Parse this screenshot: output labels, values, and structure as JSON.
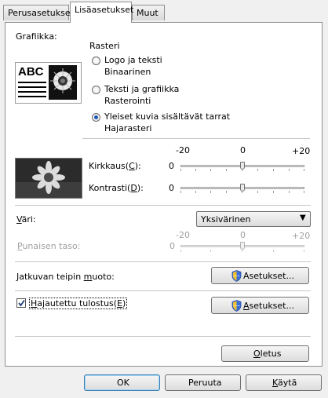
{
  "tabs": [
    {
      "label": "Perusasetukset"
    },
    {
      "label": "Lisäasetukset"
    },
    {
      "label": "Muut"
    }
  ],
  "graphics": {
    "label": "Grafiikka:",
    "sample_text": "ABC",
    "rasteri": "Rasteri",
    "options": [
      {
        "title": "Logo ja teksti",
        "sub": "Binaarinen",
        "selected": false
      },
      {
        "title": "Teksti ja grafiikka",
        "sub": "Rasterointi",
        "selected": false
      },
      {
        "title": "Yleiset kuvia sisältävät tarrat",
        "sub": "Hajarasteri",
        "selected": true
      }
    ]
  },
  "adjust": {
    "scale_min": "-20",
    "scale_mid": "0",
    "scale_max": "+20",
    "brightness_label": "Kirkkaus(C):",
    "brightness_value": "0",
    "brightness_level": 0,
    "contrast_label": "Kontrasti(D):",
    "contrast_value": "0",
    "contrast_level": 0
  },
  "color": {
    "label": "Väri:",
    "selected": "Yksivärinen",
    "red_label": "Punaisen taso:",
    "red_value": "0",
    "red_level": 0,
    "scale_min": "-20",
    "scale_mid": "0",
    "scale_max": "+20"
  },
  "continuous": {
    "label": "Jatkuvan teipin muoto:",
    "button": "Asetukset..."
  },
  "distributed": {
    "label": "Hajautettu tulostus(E)",
    "checked": true,
    "button": "Asetukset..."
  },
  "defaults_button": "Oletus",
  "footer": {
    "ok": "OK",
    "cancel": "Peruuta",
    "apply": "Käytä"
  }
}
